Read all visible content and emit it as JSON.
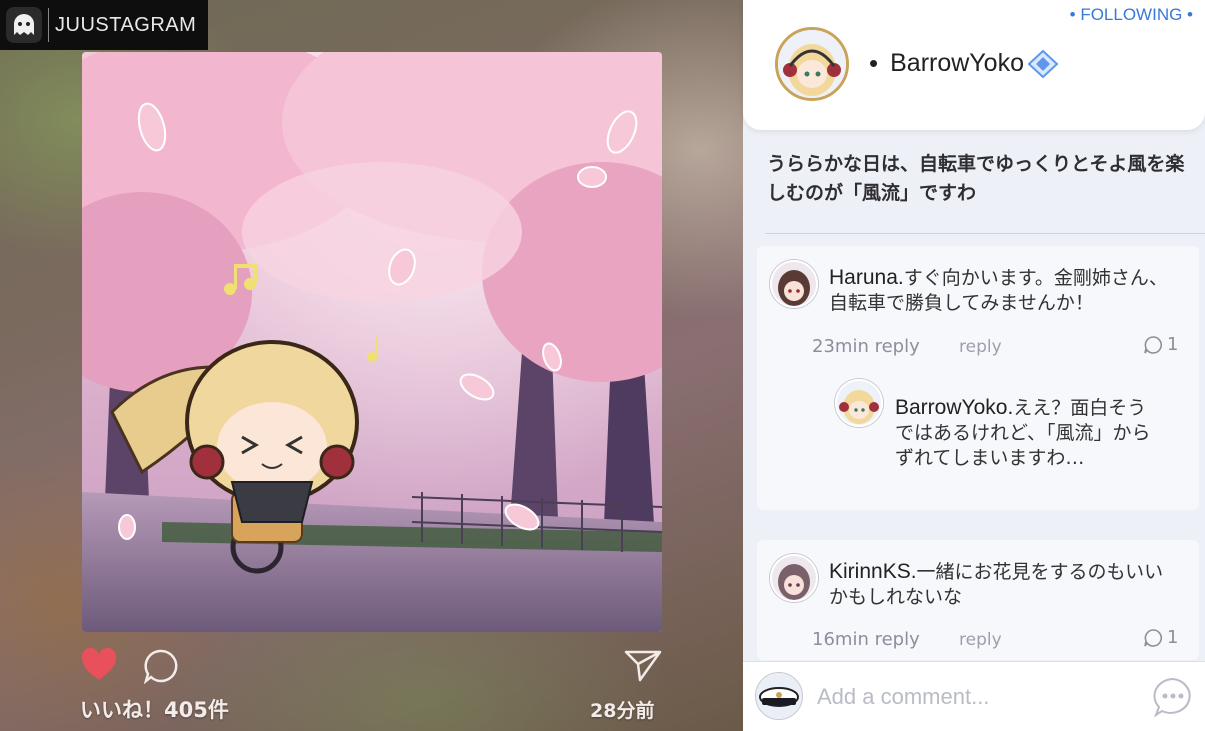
{
  "brand": {
    "name": "JUUSTAGRAM",
    "icon": "ghost-logo-icon"
  },
  "post": {
    "image_description_icon": "post-image",
    "likes": "いいね！405件",
    "time": "28分前",
    "actions": {
      "like_icon": "heart-icon",
      "comment_icon": "comment-bubble-icon",
      "share_icon": "send-arrow-icon"
    }
  },
  "header": {
    "follow_label": "• FOLLOWING •",
    "author": "BarrowYoko",
    "verified_icon": "verified-diamond-icon"
  },
  "caption": "うららかな日は、自転車でゆっくりとそよ風を楽しむのが「風流」ですわ",
  "comments": [
    {
      "user": "Haruna.",
      "text": "すぐ向かいます。金剛姉さん、自転車で勝負してみませんか！",
      "time": "23min reply",
      "reply_label": "reply",
      "reply_count": "1",
      "replies": [
        {
          "user": "BarrowYoko.",
          "text": "ええ？面白そうではあるけれど、「風流」からずれてしまいますわ…"
        }
      ]
    },
    {
      "user": "KirinnKS.",
      "text": "一緒にお花見をするのもいいかもしれないな",
      "time": "16min reply",
      "reply_label": "reply",
      "reply_count": "1"
    }
  ],
  "footer": {
    "placeholder": "Add a comment...",
    "send_icon": "speech-dots-icon"
  },
  "colors": {
    "accent": "#3a78d8",
    "like": "#e8505b",
    "panel_bg": "#eef0f7"
  }
}
